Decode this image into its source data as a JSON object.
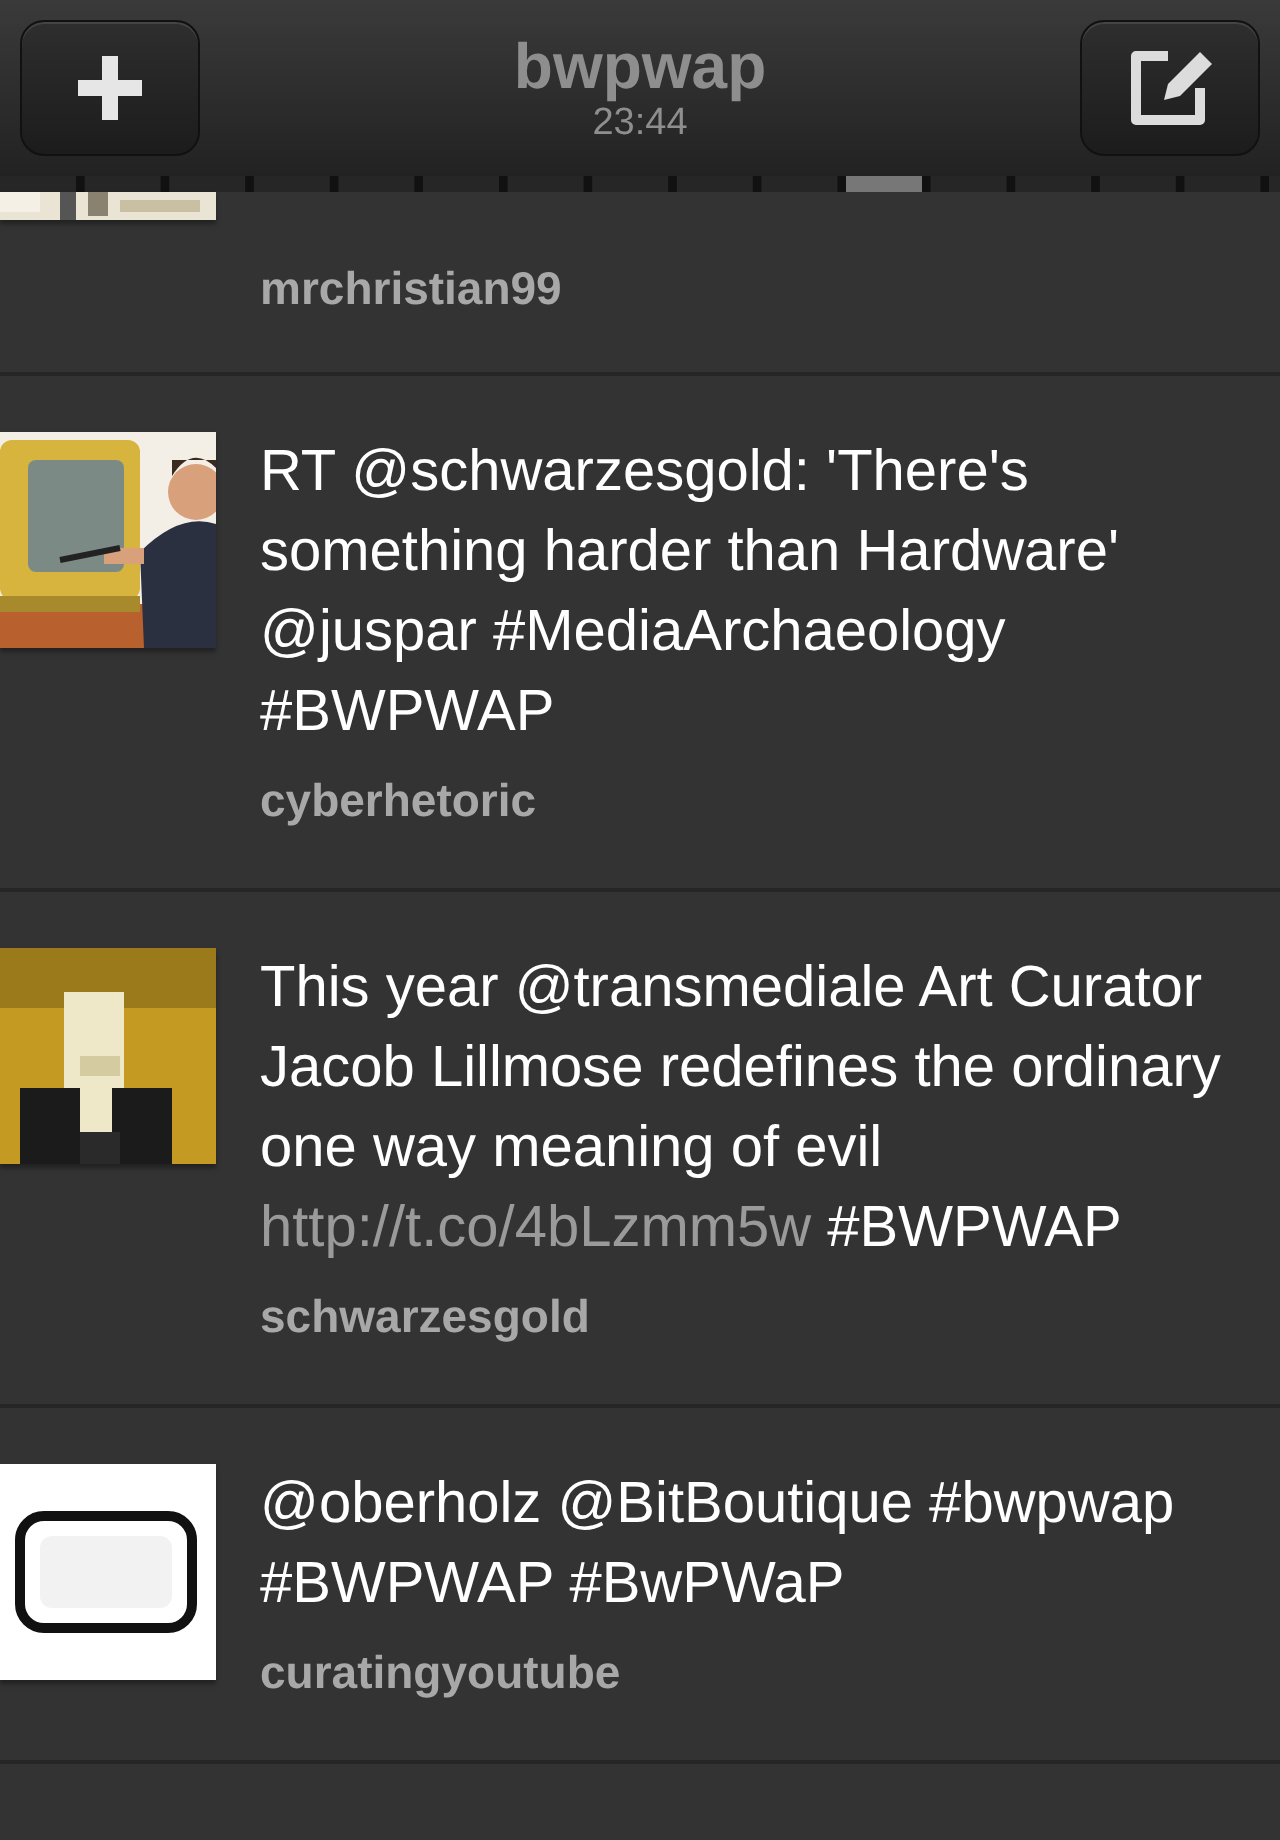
{
  "nav": {
    "title": "bwpwap",
    "subtitle": "23:44"
  },
  "tweets": [
    {
      "author": "mrchristian99"
    },
    {
      "body": [
        {
          "kind": "text",
          "text": "RT @schwarzesgold: 'There's something harder than Hardware' @juspar #MediaArchaeology #BWPWAP"
        }
      ],
      "author": "cyberhetoric"
    },
    {
      "body": [
        {
          "kind": "text",
          "text": "This year @transmediale Art Curator Jacob Lillmose redefines the ordinary one way meaning of evil "
        },
        {
          "kind": "link",
          "text": "http://t.co/4bLzmm5w"
        },
        {
          "kind": "text",
          "text": " #BWPWAP"
        }
      ],
      "author": "schwarzesgold"
    },
    {
      "body": [
        {
          "kind": "text",
          "text": "@oberholz @BitBoutique #bwpwap #BWPWAP #BwPWaP"
        }
      ],
      "author": "curatingyoutube"
    }
  ]
}
